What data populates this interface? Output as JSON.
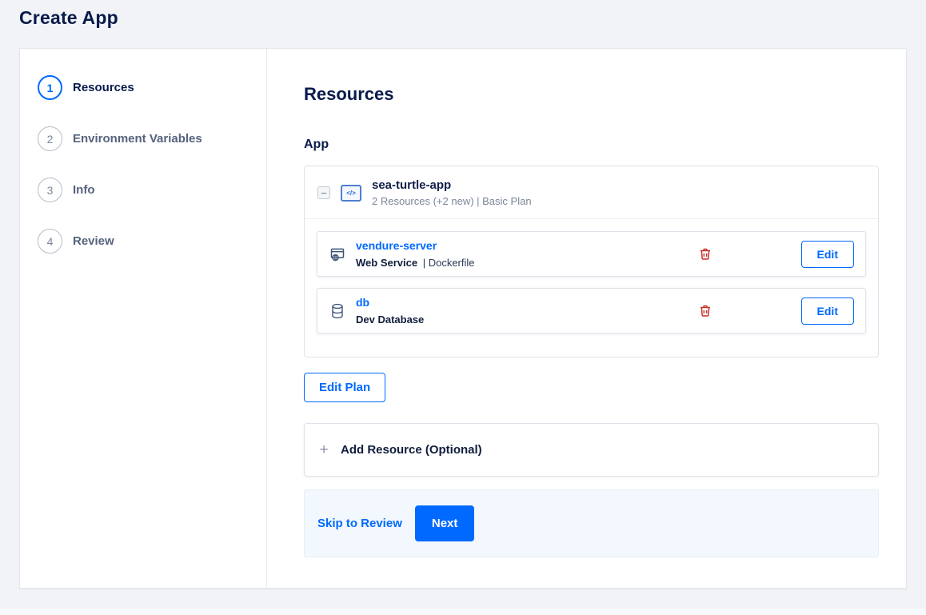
{
  "page": {
    "title": "Create App"
  },
  "stepper": {
    "steps": [
      {
        "number": "1",
        "label": "Resources"
      },
      {
        "number": "2",
        "label": "Environment Variables"
      },
      {
        "number": "3",
        "label": "Info"
      },
      {
        "number": "4",
        "label": "Review"
      }
    ]
  },
  "main": {
    "heading": "Resources",
    "section_label": "App",
    "app_group": {
      "name": "sea-turtle-app",
      "summary": "2 Resources (+2 new) | Basic Plan"
    },
    "resources": [
      {
        "name": "vendure-server",
        "type": "Web Service",
        "detail": "| Dockerfile"
      },
      {
        "name": "db",
        "type": "Dev Database",
        "detail": ""
      }
    ],
    "edit_label": "Edit",
    "edit_plan_label": "Edit Plan",
    "add_resource_label": "Add Resource (Optional)",
    "footer": {
      "skip_label": "Skip to Review",
      "next_label": "Next"
    }
  },
  "icons": {
    "collapse": "−",
    "plus": "+",
    "code": "</>"
  },
  "colors": {
    "accent": "#0069ff",
    "heading": "#081b4b",
    "danger": "#c62f26",
    "footer_bg": "#f2f8fd"
  }
}
